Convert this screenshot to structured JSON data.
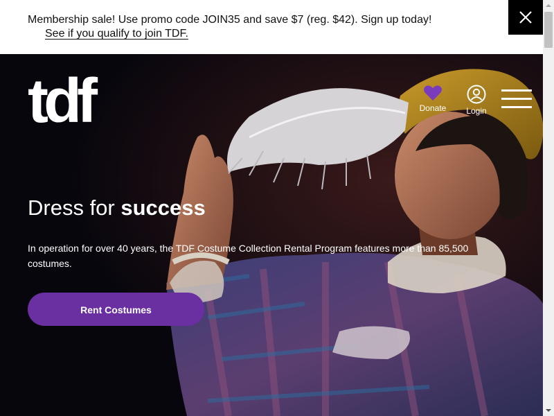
{
  "banner": {
    "message": "Membership sale! Use promo code JOIN35 and save $7 (reg. $42). Sign up today!",
    "link_text": "See if you qualify to join TDF.",
    "close_icon": "close-icon"
  },
  "header": {
    "logo_text": "tdf",
    "nav": [
      {
        "label": "Donate",
        "icon": "heart-icon"
      },
      {
        "label": "Login",
        "icon": "user-icon"
      }
    ],
    "menu_icon": "hamburger-menu-icon"
  },
  "hero": {
    "heading_regular": "Dress for ",
    "heading_bold": "success",
    "body": "In operation for over 40 years, the TDF Costume Collection Rental Program features more than 85,500 costumes.",
    "cta_label": "Rent Costumes"
  },
  "colors": {
    "accent": "#6a2fa0",
    "heart": "#7b3bbd",
    "hero_background": "#07060d",
    "banner_background": "#ffffff"
  }
}
